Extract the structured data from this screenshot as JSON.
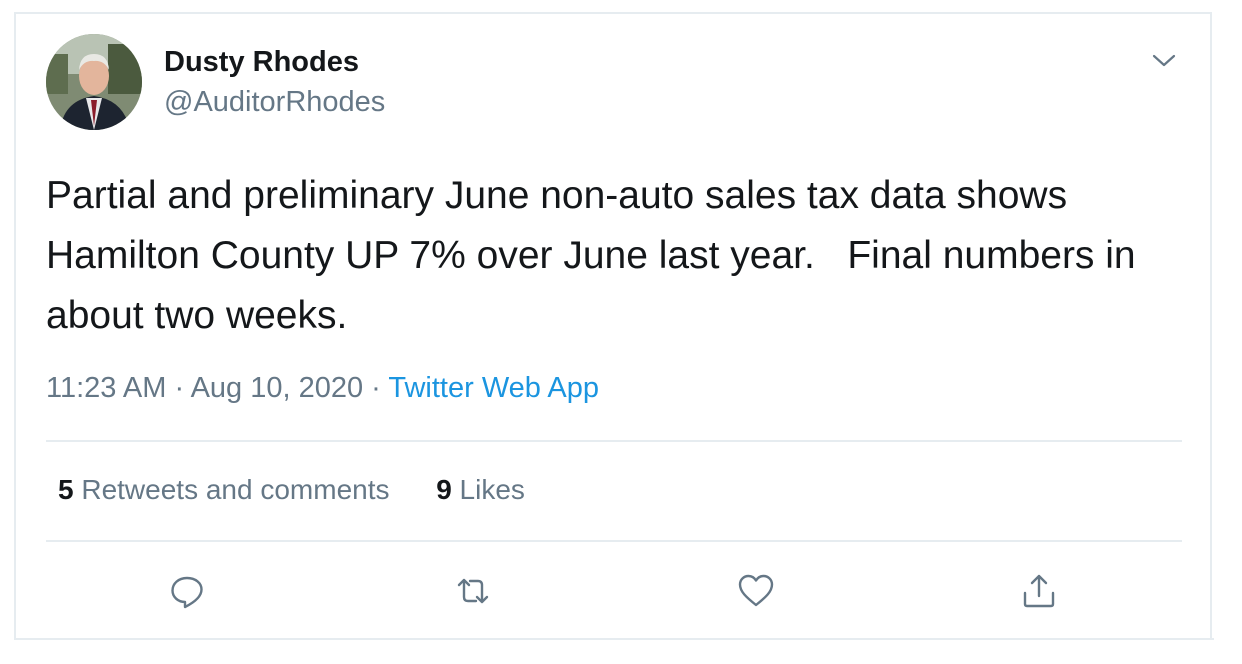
{
  "author": {
    "name": "Dusty Rhodes",
    "handle": "@AuditorRhodes"
  },
  "tweet": {
    "text": "Partial and preliminary June non-auto sales tax data shows Hamilton County UP 7% over June last year.   Final numbers in about two weeks.",
    "time": "11:23 AM",
    "separator": " · ",
    "date": "Aug 10, 2020",
    "source": "Twitter Web App"
  },
  "stats": {
    "retweets_count": "5",
    "retweets_label": "Retweets and comments",
    "likes_count": "9",
    "likes_label": "Likes"
  },
  "icons": {
    "menu": "chevron-down-icon",
    "reply": "reply-icon",
    "retweet": "retweet-icon",
    "like": "heart-icon",
    "share": "share-icon"
  },
  "colors": {
    "text": "#14171a",
    "secondary": "#657786",
    "link": "#1b95e0",
    "border": "#e6ecf0"
  }
}
